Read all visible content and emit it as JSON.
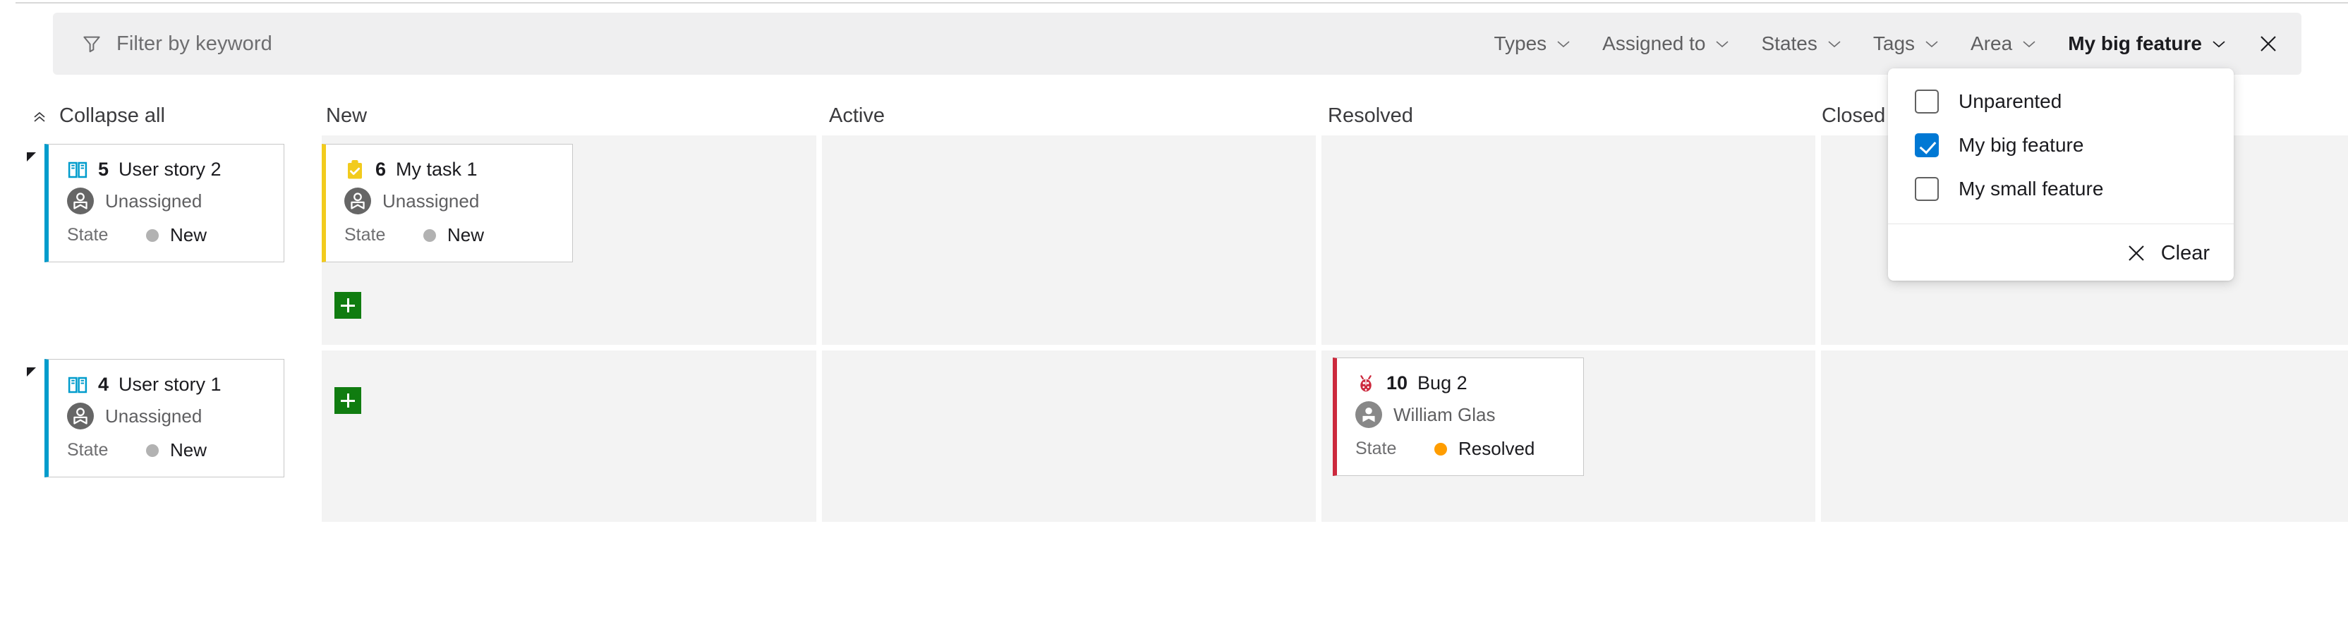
{
  "filter_bar": {
    "keyword_placeholder": "Filter by keyword",
    "funnel_icon": "funnel-icon",
    "close_icon": "close-icon",
    "pills": [
      {
        "label": "Types",
        "selected": false
      },
      {
        "label": "Assigned to",
        "selected": false
      },
      {
        "label": "States",
        "selected": false
      },
      {
        "label": "Tags",
        "selected": false
      },
      {
        "label": "Area",
        "selected": false
      },
      {
        "label": "My big feature",
        "selected": true
      }
    ]
  },
  "dropdown": {
    "options": [
      {
        "label": "Unparented",
        "checked": false
      },
      {
        "label": "My big feature",
        "checked": true
      },
      {
        "label": "My small feature",
        "checked": false
      }
    ],
    "clear_label": "Clear",
    "clear_icon": "close-icon"
  },
  "board": {
    "collapse_all_label": "Collapse all",
    "collapse_all_icon": "double-chevron-up-icon",
    "columns": [
      {
        "label": "New"
      },
      {
        "label": "Active"
      },
      {
        "label": "Resolved"
      },
      {
        "label": "Closed"
      }
    ],
    "state_field_label": "State",
    "add_icon": "plus-icon",
    "colors": {
      "user_story": "#009ccc",
      "task": "#f2cb1d",
      "bug": "#cc293d",
      "state_new_dot": "#b2b2b2",
      "state_resolved_dot": "#ff9d00",
      "add_button": "#107c10",
      "checkbox_checked": "#0078d4"
    },
    "swimlanes": [
      {
        "parent": {
          "id": "5",
          "title": "User story 2",
          "type_icon": "user-story-icon",
          "assignee": "Unassigned",
          "assignee_icon": "unassigned-avatar-icon",
          "state": "New",
          "state_kind": "new"
        },
        "cells": [
          {
            "column": "New",
            "cards": [
              {
                "id": "6",
                "title": "My task 1",
                "type": "task",
                "type_icon": "task-icon",
                "assignee": "Unassigned",
                "assignee_icon": "unassigned-avatar-icon",
                "state": "New",
                "state_kind": "new"
              }
            ],
            "has_add": true
          },
          {
            "column": "Active",
            "cards": [],
            "has_add": false
          },
          {
            "column": "Resolved",
            "cards": [],
            "has_add": false
          },
          {
            "column": "Closed",
            "cards": [],
            "has_add": false
          }
        ]
      },
      {
        "parent": {
          "id": "4",
          "title": "User story 1",
          "type_icon": "user-story-icon",
          "assignee": "Unassigned",
          "assignee_icon": "unassigned-avatar-icon",
          "state": "New",
          "state_kind": "new"
        },
        "cells": [
          {
            "column": "New",
            "cards": [],
            "has_add": true
          },
          {
            "column": "Active",
            "cards": [],
            "has_add": false
          },
          {
            "column": "Resolved",
            "cards": [
              {
                "id": "10",
                "title": "Bug 2",
                "type": "bug",
                "type_icon": "bug-icon",
                "assignee": "William Glas",
                "assignee_icon": "person-avatar-icon",
                "state": "Resolved",
                "state_kind": "resolved"
              }
            ],
            "has_add": false
          },
          {
            "column": "Closed",
            "cards": [],
            "has_add": false
          }
        ]
      }
    ]
  }
}
